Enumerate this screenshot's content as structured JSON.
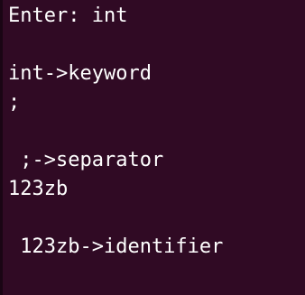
{
  "terminal": {
    "background": "#300a24",
    "foreground": "#ffffff",
    "lines": [
      "Enter: int",
      "",
      "int->keyword",
      ";",
      "",
      " ;->separator",
      "123zb",
      "",
      " 123zb->identifier",
      ""
    ]
  }
}
